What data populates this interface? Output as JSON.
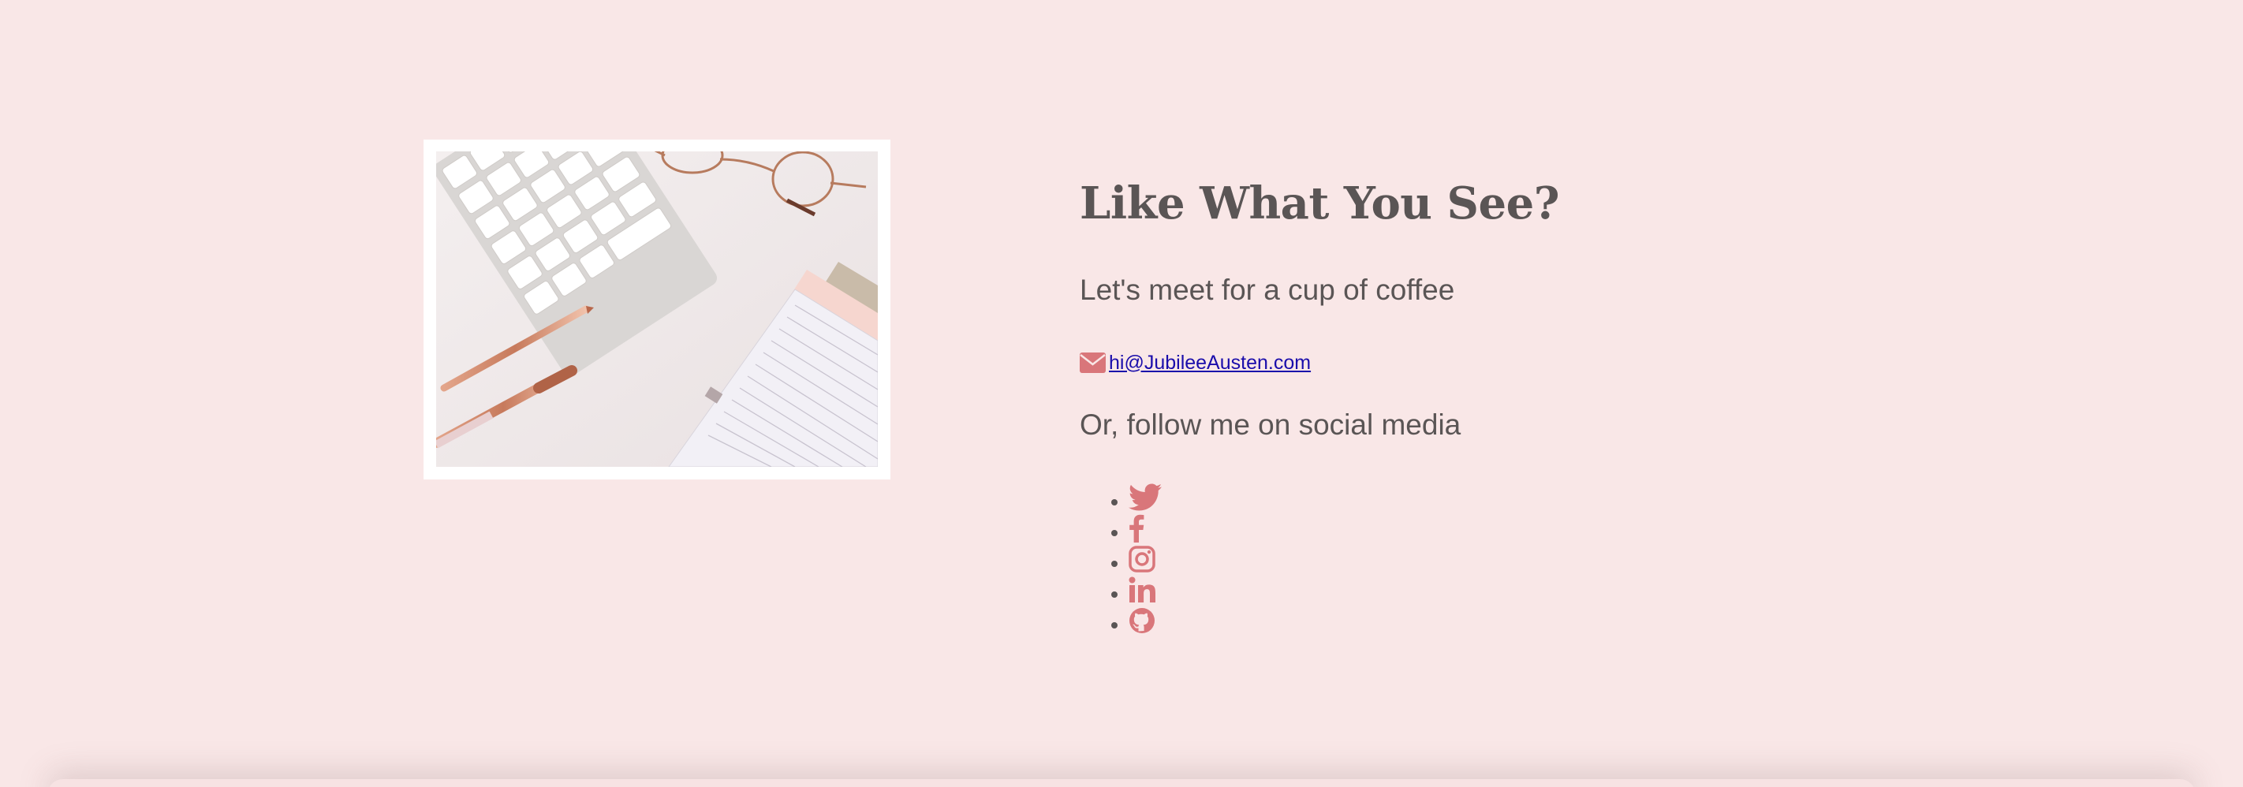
{
  "contact": {
    "heading": "Like What You See?",
    "tagline": "Let's meet for a cup of coffee",
    "email": "hi@JubileeAusten.com",
    "follow_text": "Or, follow me on social media"
  },
  "social": {
    "items": [
      {
        "icon": "twitter-icon"
      },
      {
        "icon": "facebook-icon"
      },
      {
        "icon": "instagram-icon"
      },
      {
        "icon": "linkedin-icon"
      },
      {
        "icon": "github-icon"
      }
    ]
  },
  "colors": {
    "background": "#f9e7e7",
    "text": "#5a5555",
    "accent": "#d9767a",
    "link": "#1a0dab",
    "frame": "#ffffff"
  }
}
